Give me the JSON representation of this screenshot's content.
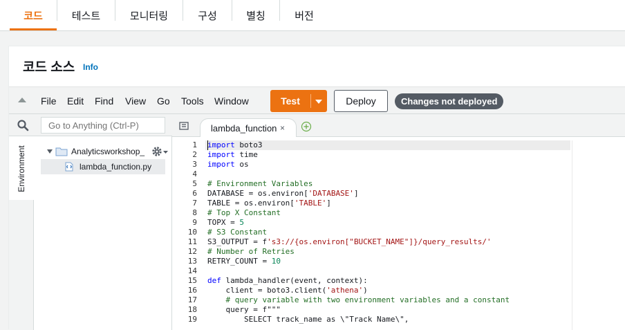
{
  "tabs": [
    {
      "label": "코드",
      "active": true
    },
    {
      "label": "테스트"
    },
    {
      "label": "모니터링"
    },
    {
      "label": "구성"
    },
    {
      "label": "별칭"
    },
    {
      "label": "버전"
    }
  ],
  "section": {
    "title": "코드 소스",
    "info": "Info"
  },
  "menu": [
    "File",
    "Edit",
    "Find",
    "View",
    "Go",
    "Tools",
    "Window"
  ],
  "buttons": {
    "test": "Test",
    "deploy": "Deploy"
  },
  "status_badge": "Changes not deployed",
  "search": {
    "placeholder": "Go to Anything (Ctrl-P)"
  },
  "env_tab": "Environment",
  "tree": {
    "folder": "Analyticsworkshop_",
    "file": "lambda_function.py"
  },
  "editor_tab": {
    "label": "lambda_function",
    "close": "×"
  },
  "code_lines": [
    "import boto3",
    "import time",
    "import os",
    "",
    "# Environment Variables",
    "DATABASE = os.environ['DATABASE']",
    "TABLE = os.environ['TABLE']",
    "# Top X Constant",
    "TOPX = 5",
    "# S3 Constant",
    "S3_OUTPUT = f's3://{os.environ[\"BUCKET_NAME\"]}/query_results/'",
    "# Number of Retries",
    "RETRY_COUNT = 10",
    "",
    "def lambda_handler(event, context):",
    "    client = boto3.client('athena')",
    "    # query variable with two environment variables and a constant",
    "    query = f\"\"\"",
    "        SELECT track_name as \\\"Track Name\\\","
  ],
  "colors": {
    "accent": "#ec7211",
    "link": "#0073bb",
    "badge": "#545b64"
  }
}
